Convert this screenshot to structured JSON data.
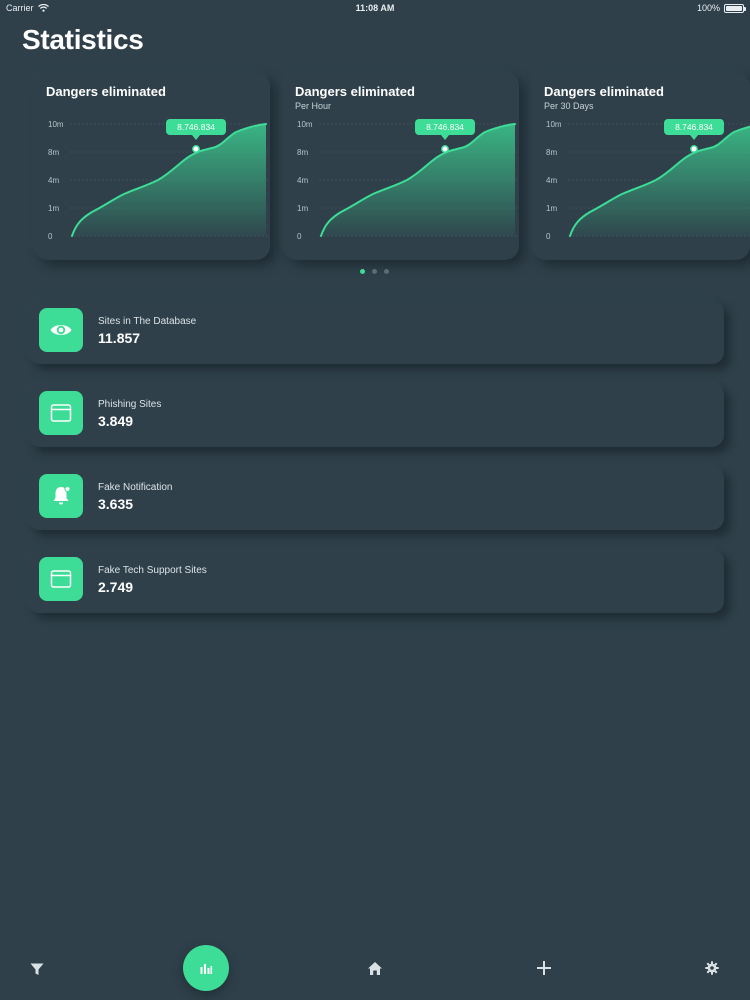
{
  "status_bar": {
    "carrier": "Carrier",
    "time": "11:08 AM",
    "battery": "100%"
  },
  "page": {
    "title": "Statistics"
  },
  "cards": [
    {
      "title": "Dangers eliminated",
      "subtitle": "",
      "tooltip": "8.746.834"
    },
    {
      "title": "Dangers eliminated",
      "subtitle": "Per Hour",
      "tooltip": "8.746.834"
    },
    {
      "title": "Dangers eliminated",
      "subtitle": "Per 30 Days",
      "tooltip": "8.746.834"
    }
  ],
  "axis_labels": [
    "10m",
    "8m",
    "4m",
    "1m",
    "0"
  ],
  "pager": {
    "count": 3,
    "active": 0
  },
  "stats": [
    {
      "label": "Sites in The Database",
      "value": "11.857",
      "icon": "eye-icon"
    },
    {
      "label": "Phishing Sites",
      "value": "3.849",
      "icon": "browser-window-icon"
    },
    {
      "label": "Fake Notification",
      "value": "3.635",
      "icon": "bell-icon"
    },
    {
      "label": "Fake Tech Support Sites",
      "value": "2.749",
      "icon": "browser-window-icon"
    }
  ],
  "tabbar": {
    "items": [
      {
        "name": "filter",
        "icon": "filter-icon",
        "active": false
      },
      {
        "name": "statistics",
        "icon": "bar-chart-icon",
        "active": true
      },
      {
        "name": "home",
        "icon": "home-icon",
        "active": false
      },
      {
        "name": "add",
        "icon": "plus-icon",
        "active": false
      },
      {
        "name": "settings",
        "icon": "gear-icon",
        "active": false
      }
    ]
  },
  "colors": {
    "background": "#2f404a",
    "accent": "#3ddc97",
    "text": "#ffffff"
  }
}
